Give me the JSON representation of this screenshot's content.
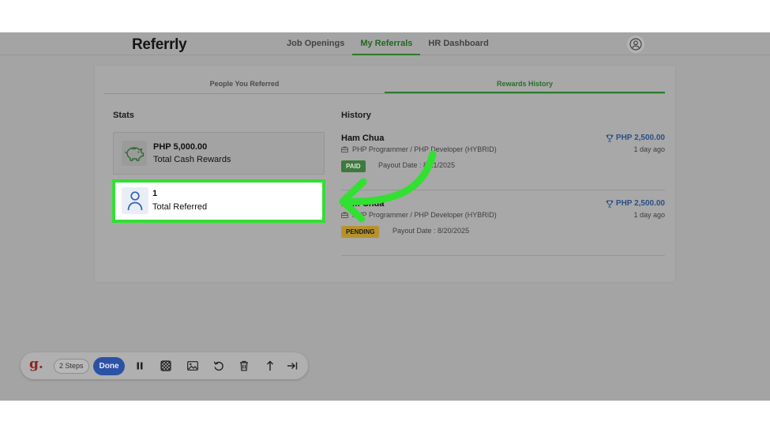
{
  "app": {
    "brand": "Referrly"
  },
  "nav": {
    "items": [
      {
        "label": "Job Openings"
      },
      {
        "label": "My Referrals"
      },
      {
        "label": "HR Dashboard"
      }
    ],
    "active": "My Referrals"
  },
  "tabs": [
    {
      "label": "People You Referred"
    },
    {
      "label": "Rewards History"
    }
  ],
  "stats": {
    "title": "Stats",
    "cash": {
      "value": "PHP 5,000.00",
      "label": "Total Cash Rewards"
    },
    "referred": {
      "value": "1",
      "label": "Total Referred"
    }
  },
  "history": {
    "title": "History",
    "items": [
      {
        "name": "Ham Chua",
        "job": "PHP Programmer / PHP Developer (HYBRID)",
        "amount": "PHP 2,500.00",
        "time": "1 day ago",
        "status": "PAID",
        "payout": "Payout Date : 8/21/2025"
      },
      {
        "name": "Ham Chua",
        "job": "PHP Programmer / PHP Developer (HYBRID)",
        "amount": "PHP 2,500.00",
        "time": "1 day ago",
        "status": "PENDING",
        "payout": "Payout Date : 8/20/2025"
      }
    ]
  },
  "toolbar": {
    "logo": "g.",
    "steps": "2 Steps",
    "done": "Done"
  },
  "colors": {
    "highlight": "#32e032",
    "arrow": "#32e032",
    "accent_green": "#2d7a2d",
    "done_blue": "#2c52a6"
  },
  "icons": [
    "user-circle-icon",
    "piggy-bank-icon",
    "person-icon",
    "trophy-icon",
    "briefcase-icon",
    "pause-icon",
    "blur-icon",
    "image-icon",
    "undo-icon",
    "trash-icon",
    "arrow-up-icon",
    "skip-end-icon"
  ]
}
